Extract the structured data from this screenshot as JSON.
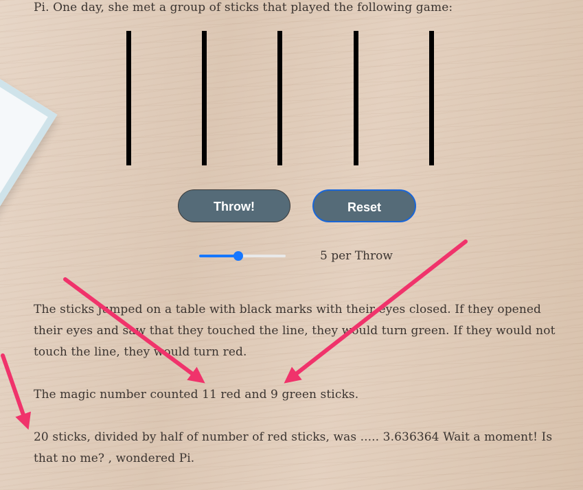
{
  "story": {
    "intro": "Pi. One day, she met a group of sticks that played the following game:",
    "paragraph1": "The sticks jumped on a table with black marks with their eyes closed. If they opened their eyes and saw that they touched the line, they would turn green. If they would not touch the line, they would turn red.",
    "paragraph2": "The magic number counted 11 red and 9 green sticks.",
    "paragraph3": "20 sticks, divided by half of number of red sticks, was ..... 3.636364 Wait a moment! Is that no me? , wondered Pi."
  },
  "controls": {
    "throw_label": "Throw!",
    "reset_label": "Reset",
    "slider_value_fraction": 0.45,
    "slider_label": "5 per Throw"
  },
  "colors": {
    "button_bg": "#556b78",
    "reset_border": "#1a66d6",
    "slider_accent": "#1677ff",
    "arrow": "#f0336b"
  },
  "icons": {
    "annotation": "pink-arrow-icon"
  }
}
